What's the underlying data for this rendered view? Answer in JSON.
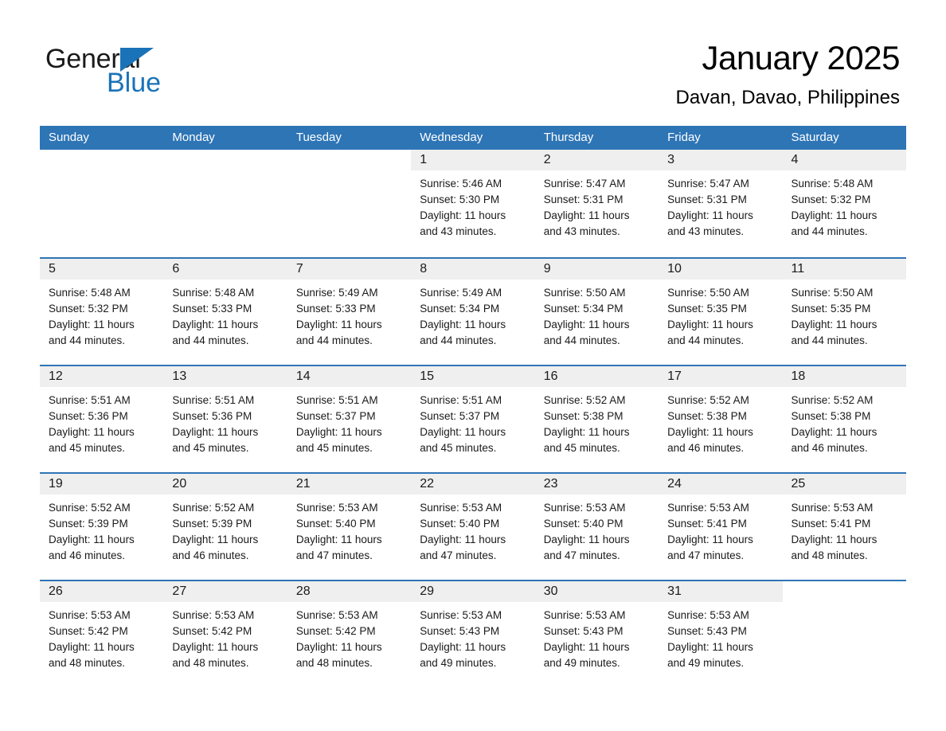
{
  "brand": {
    "name_part1": "General",
    "name_part2": "Blue",
    "accent_color": "#1a73b8",
    "header_color": "#2e75b6"
  },
  "header": {
    "month_title": "January 2025",
    "location": "Davan, Davao, Philippines"
  },
  "weekdays": [
    "Sunday",
    "Monday",
    "Tuesday",
    "Wednesday",
    "Thursday",
    "Friday",
    "Saturday"
  ],
  "labels": {
    "sunrise_prefix": "Sunrise:",
    "sunset_prefix": "Sunset:",
    "daylight_prefix": "Daylight:"
  },
  "weeks": [
    [
      {
        "day": "",
        "sunrise": "",
        "sunset": "",
        "daylight_line1": "",
        "daylight_line2": "",
        "empty": true
      },
      {
        "day": "",
        "sunrise": "",
        "sunset": "",
        "daylight_line1": "",
        "daylight_line2": "",
        "empty": true
      },
      {
        "day": "",
        "sunrise": "",
        "sunset": "",
        "daylight_line1": "",
        "daylight_line2": "",
        "empty": true
      },
      {
        "day": "1",
        "sunrise": "Sunrise: 5:46 AM",
        "sunset": "Sunset: 5:30 PM",
        "daylight_line1": "Daylight: 11 hours",
        "daylight_line2": "and 43 minutes.",
        "empty": false
      },
      {
        "day": "2",
        "sunrise": "Sunrise: 5:47 AM",
        "sunset": "Sunset: 5:31 PM",
        "daylight_line1": "Daylight: 11 hours",
        "daylight_line2": "and 43 minutes.",
        "empty": false
      },
      {
        "day": "3",
        "sunrise": "Sunrise: 5:47 AM",
        "sunset": "Sunset: 5:31 PM",
        "daylight_line1": "Daylight: 11 hours",
        "daylight_line2": "and 43 minutes.",
        "empty": false
      },
      {
        "day": "4",
        "sunrise": "Sunrise: 5:48 AM",
        "sunset": "Sunset: 5:32 PM",
        "daylight_line1": "Daylight: 11 hours",
        "daylight_line2": "and 44 minutes.",
        "empty": false
      }
    ],
    [
      {
        "day": "5",
        "sunrise": "Sunrise: 5:48 AM",
        "sunset": "Sunset: 5:32 PM",
        "daylight_line1": "Daylight: 11 hours",
        "daylight_line2": "and 44 minutes.",
        "empty": false
      },
      {
        "day": "6",
        "sunrise": "Sunrise: 5:48 AM",
        "sunset": "Sunset: 5:33 PM",
        "daylight_line1": "Daylight: 11 hours",
        "daylight_line2": "and 44 minutes.",
        "empty": false
      },
      {
        "day": "7",
        "sunrise": "Sunrise: 5:49 AM",
        "sunset": "Sunset: 5:33 PM",
        "daylight_line1": "Daylight: 11 hours",
        "daylight_line2": "and 44 minutes.",
        "empty": false
      },
      {
        "day": "8",
        "sunrise": "Sunrise: 5:49 AM",
        "sunset": "Sunset: 5:34 PM",
        "daylight_line1": "Daylight: 11 hours",
        "daylight_line2": "and 44 minutes.",
        "empty": false
      },
      {
        "day": "9",
        "sunrise": "Sunrise: 5:50 AM",
        "sunset": "Sunset: 5:34 PM",
        "daylight_line1": "Daylight: 11 hours",
        "daylight_line2": "and 44 minutes.",
        "empty": false
      },
      {
        "day": "10",
        "sunrise": "Sunrise: 5:50 AM",
        "sunset": "Sunset: 5:35 PM",
        "daylight_line1": "Daylight: 11 hours",
        "daylight_line2": "and 44 minutes.",
        "empty": false
      },
      {
        "day": "11",
        "sunrise": "Sunrise: 5:50 AM",
        "sunset": "Sunset: 5:35 PM",
        "daylight_line1": "Daylight: 11 hours",
        "daylight_line2": "and 44 minutes.",
        "empty": false
      }
    ],
    [
      {
        "day": "12",
        "sunrise": "Sunrise: 5:51 AM",
        "sunset": "Sunset: 5:36 PM",
        "daylight_line1": "Daylight: 11 hours",
        "daylight_line2": "and 45 minutes.",
        "empty": false
      },
      {
        "day": "13",
        "sunrise": "Sunrise: 5:51 AM",
        "sunset": "Sunset: 5:36 PM",
        "daylight_line1": "Daylight: 11 hours",
        "daylight_line2": "and 45 minutes.",
        "empty": false
      },
      {
        "day": "14",
        "sunrise": "Sunrise: 5:51 AM",
        "sunset": "Sunset: 5:37 PM",
        "daylight_line1": "Daylight: 11 hours",
        "daylight_line2": "and 45 minutes.",
        "empty": false
      },
      {
        "day": "15",
        "sunrise": "Sunrise: 5:51 AM",
        "sunset": "Sunset: 5:37 PM",
        "daylight_line1": "Daylight: 11 hours",
        "daylight_line2": "and 45 minutes.",
        "empty": false
      },
      {
        "day": "16",
        "sunrise": "Sunrise: 5:52 AM",
        "sunset": "Sunset: 5:38 PM",
        "daylight_line1": "Daylight: 11 hours",
        "daylight_line2": "and 45 minutes.",
        "empty": false
      },
      {
        "day": "17",
        "sunrise": "Sunrise: 5:52 AM",
        "sunset": "Sunset: 5:38 PM",
        "daylight_line1": "Daylight: 11 hours",
        "daylight_line2": "and 46 minutes.",
        "empty": false
      },
      {
        "day": "18",
        "sunrise": "Sunrise: 5:52 AM",
        "sunset": "Sunset: 5:38 PM",
        "daylight_line1": "Daylight: 11 hours",
        "daylight_line2": "and 46 minutes.",
        "empty": false
      }
    ],
    [
      {
        "day": "19",
        "sunrise": "Sunrise: 5:52 AM",
        "sunset": "Sunset: 5:39 PM",
        "daylight_line1": "Daylight: 11 hours",
        "daylight_line2": "and 46 minutes.",
        "empty": false
      },
      {
        "day": "20",
        "sunrise": "Sunrise: 5:52 AM",
        "sunset": "Sunset: 5:39 PM",
        "daylight_line1": "Daylight: 11 hours",
        "daylight_line2": "and 46 minutes.",
        "empty": false
      },
      {
        "day": "21",
        "sunrise": "Sunrise: 5:53 AM",
        "sunset": "Sunset: 5:40 PM",
        "daylight_line1": "Daylight: 11 hours",
        "daylight_line2": "and 47 minutes.",
        "empty": false
      },
      {
        "day": "22",
        "sunrise": "Sunrise: 5:53 AM",
        "sunset": "Sunset: 5:40 PM",
        "daylight_line1": "Daylight: 11 hours",
        "daylight_line2": "and 47 minutes.",
        "empty": false
      },
      {
        "day": "23",
        "sunrise": "Sunrise: 5:53 AM",
        "sunset": "Sunset: 5:40 PM",
        "daylight_line1": "Daylight: 11 hours",
        "daylight_line2": "and 47 minutes.",
        "empty": false
      },
      {
        "day": "24",
        "sunrise": "Sunrise: 5:53 AM",
        "sunset": "Sunset: 5:41 PM",
        "daylight_line1": "Daylight: 11 hours",
        "daylight_line2": "and 47 minutes.",
        "empty": false
      },
      {
        "day": "25",
        "sunrise": "Sunrise: 5:53 AM",
        "sunset": "Sunset: 5:41 PM",
        "daylight_line1": "Daylight: 11 hours",
        "daylight_line2": "and 48 minutes.",
        "empty": false
      }
    ],
    [
      {
        "day": "26",
        "sunrise": "Sunrise: 5:53 AM",
        "sunset": "Sunset: 5:42 PM",
        "daylight_line1": "Daylight: 11 hours",
        "daylight_line2": "and 48 minutes.",
        "empty": false
      },
      {
        "day": "27",
        "sunrise": "Sunrise: 5:53 AM",
        "sunset": "Sunset: 5:42 PM",
        "daylight_line1": "Daylight: 11 hours",
        "daylight_line2": "and 48 minutes.",
        "empty": false
      },
      {
        "day": "28",
        "sunrise": "Sunrise: 5:53 AM",
        "sunset": "Sunset: 5:42 PM",
        "daylight_line1": "Daylight: 11 hours",
        "daylight_line2": "and 48 minutes.",
        "empty": false
      },
      {
        "day": "29",
        "sunrise": "Sunrise: 5:53 AM",
        "sunset": "Sunset: 5:43 PM",
        "daylight_line1": "Daylight: 11 hours",
        "daylight_line2": "and 49 minutes.",
        "empty": false
      },
      {
        "day": "30",
        "sunrise": "Sunrise: 5:53 AM",
        "sunset": "Sunset: 5:43 PM",
        "daylight_line1": "Daylight: 11 hours",
        "daylight_line2": "and 49 minutes.",
        "empty": false
      },
      {
        "day": "31",
        "sunrise": "Sunrise: 5:53 AM",
        "sunset": "Sunset: 5:43 PM",
        "daylight_line1": "Daylight: 11 hours",
        "daylight_line2": "and 49 minutes.",
        "empty": false
      },
      {
        "day": "",
        "sunrise": "",
        "sunset": "",
        "daylight_line1": "",
        "daylight_line2": "",
        "empty": true
      }
    ]
  ]
}
